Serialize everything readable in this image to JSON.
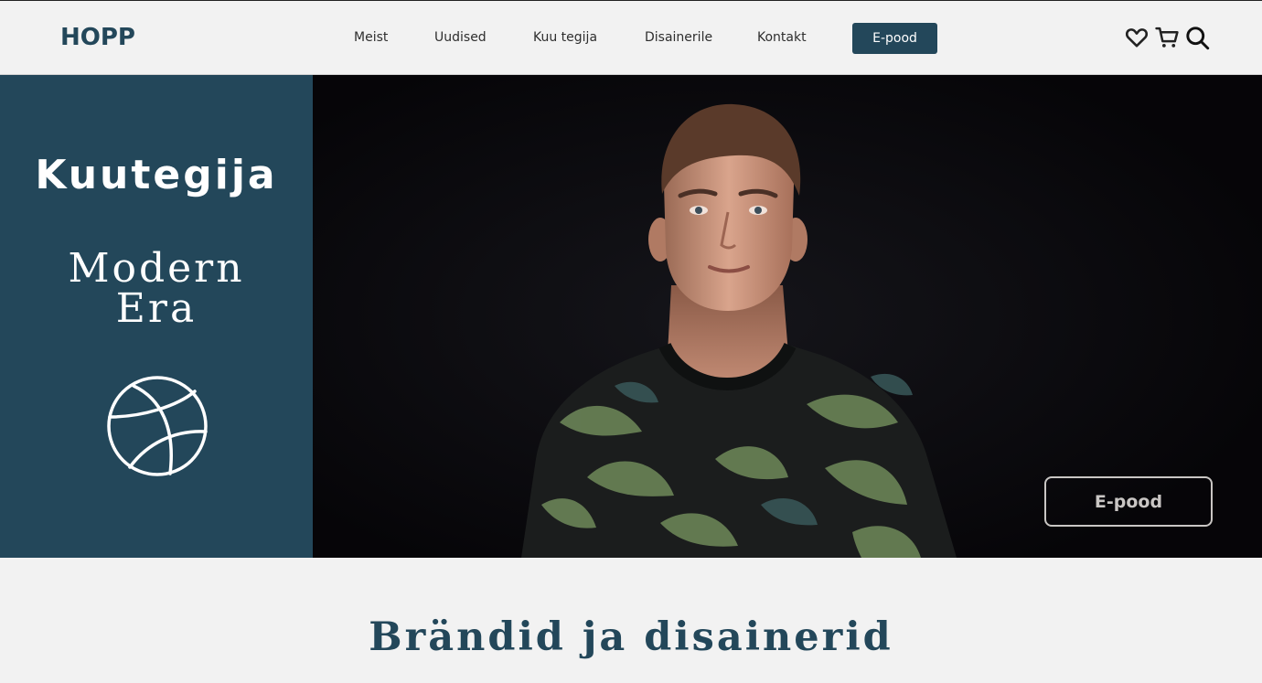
{
  "header": {
    "logo": "HOPP",
    "nav": [
      "Meist",
      "Uudised",
      "Kuu tegija",
      "Disainerile",
      "Kontakt"
    ],
    "shop_button": "E-pood",
    "icons": [
      "heart-icon",
      "cart-icon",
      "search-icon"
    ]
  },
  "hero": {
    "title": "Kuutegija",
    "subtitle_line1": "Modern",
    "subtitle_line2": "Era",
    "emblem_icon": "basketball-icon",
    "cta": "E-pood"
  },
  "section": {
    "title": "Brändid ja disainerid"
  },
  "colors": {
    "brand": "#23475a",
    "background": "#f2f2f2",
    "photo_bg": "#08070a"
  }
}
